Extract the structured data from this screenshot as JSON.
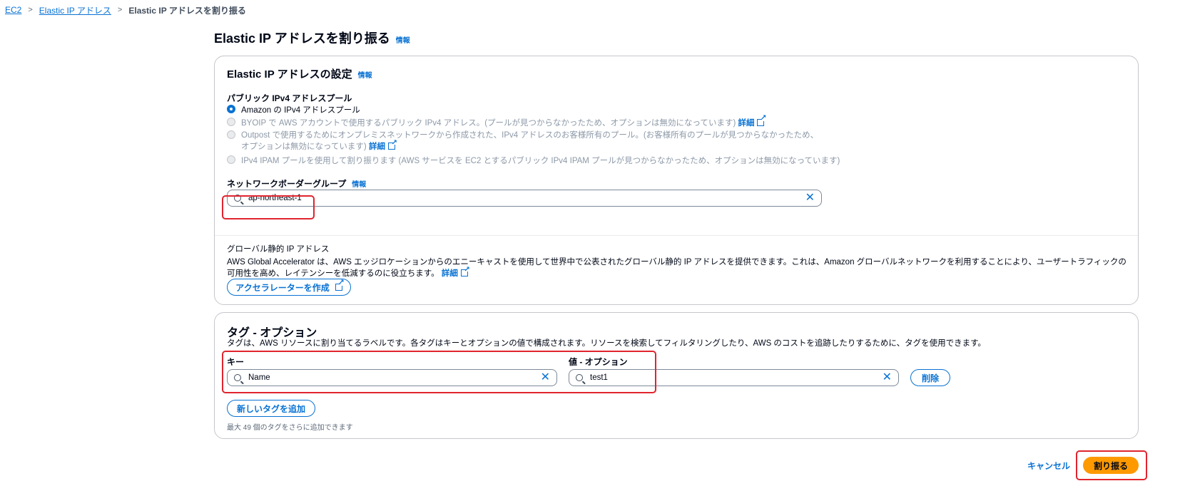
{
  "breadcrumb": {
    "items": [
      "EC2",
      "Elastic IP アドレス"
    ],
    "current": "Elastic IP アドレスを割り振る",
    "separator": ">"
  },
  "page": {
    "title": "Elastic IP アドレスを割り振る",
    "info_label": "情報"
  },
  "settings_panel": {
    "title": "Elastic IP アドレスの設定",
    "info_label": "情報",
    "pool_label": "パブリック IPv4 アドレスプール",
    "options": [
      {
        "text": "Amazon の IPv4 アドレスプール",
        "selected": true,
        "disabled": false,
        "link": ""
      },
      {
        "text": "BYOIP で AWS アカウントで使用するパブリック IPv4 アドレス。(プールが見つからなかったため、オプションは無効になっています)",
        "selected": false,
        "disabled": true,
        "link": "詳細"
      },
      {
        "text": "Outpost で使用するためにオンプレミスネットワークから作成された、IPv4 アドレスのお客様所有のプール。(お客様所有のプールが見つからなかったため、オプションは無効になっています)",
        "selected": false,
        "disabled": true,
        "link": "詳細"
      },
      {
        "text": "IPv4 IPAM プールを使用して割り振ります (AWS サービスを EC2 とするパブリック IPv4 IPAM プールが見つからなかったため、オプションは無効になっています)",
        "selected": false,
        "disabled": true,
        "link": ""
      }
    ],
    "nbg_label": "ネットワークボーダーグループ",
    "nbg_info": "情報",
    "nbg_value": "ap-northeast-1",
    "global_ip_label": "グローバル静的 IP アドレス",
    "global_ip_desc": "AWS Global Accelerator は、AWS エッジロケーションからのエニーキャストを使用して世界中で公表されたグローバル静的 IP アドレスを提供できます。これは、Amazon グローバルネットワークを利用することにより、ユーザートラフィックの可用性を高め、レイテンシーを低減するのに役立ちます。",
    "global_ip_link": "詳細",
    "create_accelerator_label": "アクセラレーターを作成"
  },
  "tags_panel": {
    "title": "タグ - オプション",
    "description": "タグは、AWS リソースに割り当てるラベルです。各タグはキーとオプションの値で構成されます。リソースを検索してフィルタリングしたり、AWS のコストを追跡したりするために、タグを使用できます。",
    "key_label": "キー",
    "value_label": "値 - オプション",
    "key_value": "Name",
    "value_value": "test1",
    "remove_label": "削除",
    "add_tag_label": "新しいタグを追加",
    "limit_hint": "最大 49 個のタグをさらに追加できます"
  },
  "footer": {
    "cancel_label": "キャンセル",
    "allocate_label": "割り振る"
  },
  "colors": {
    "link": "#0972d3",
    "primary": "#ff9900",
    "highlight": "#e0242e"
  }
}
